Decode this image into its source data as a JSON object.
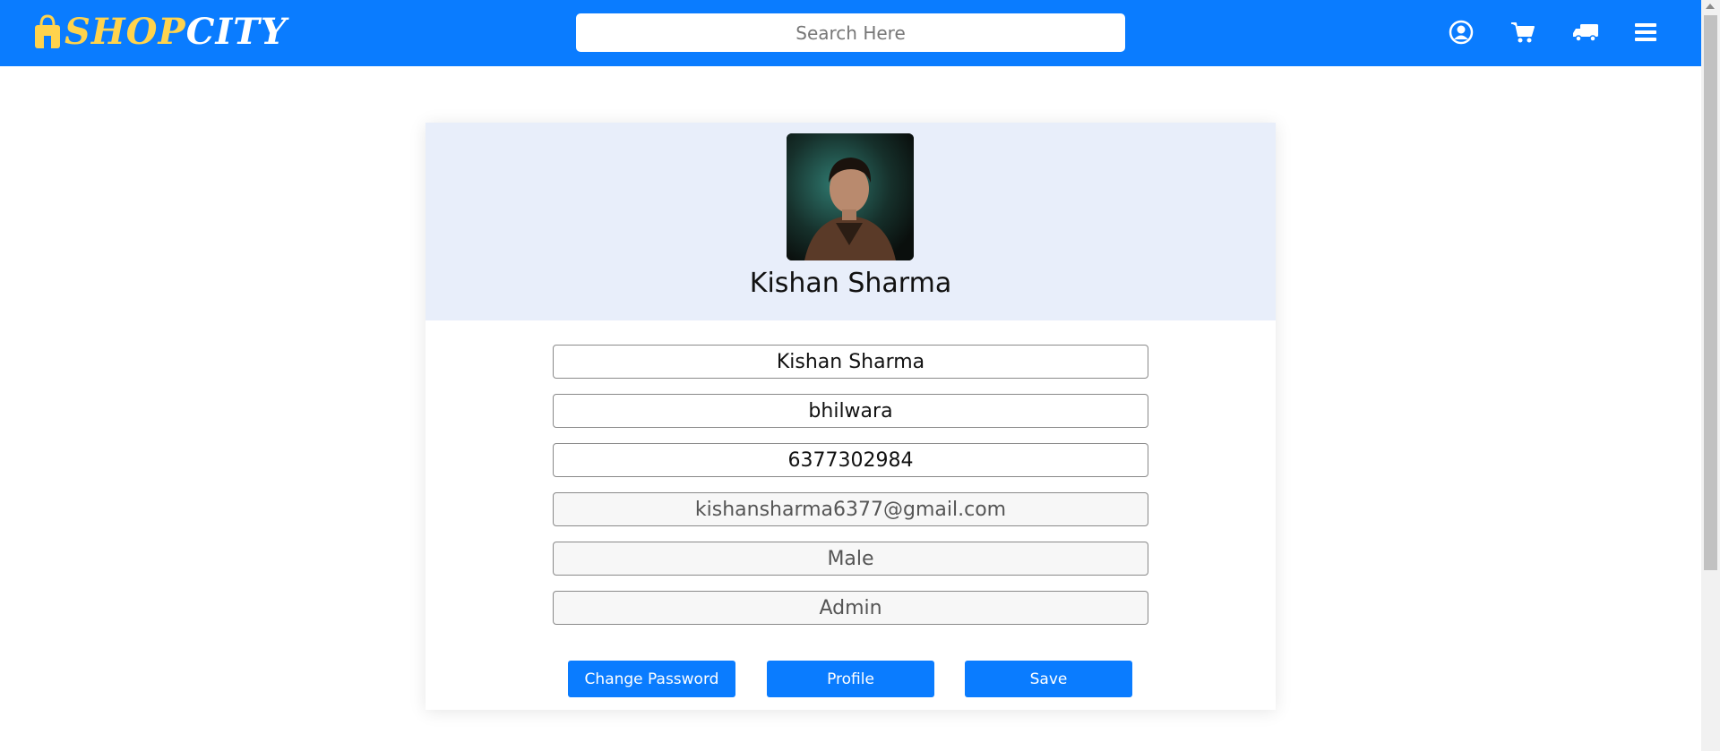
{
  "header": {
    "logo": {
      "shop": "SHOP",
      "city": "CITY"
    },
    "search": {
      "placeholder": "Search Here",
      "value": ""
    },
    "icons": [
      "user-circle-icon",
      "cart-icon",
      "truck-icon",
      "menu-icon"
    ],
    "colors": {
      "bar": "#0a7cff",
      "logo_shop": "#ffd34d",
      "logo_city": "#ffffff"
    }
  },
  "profile": {
    "name": "Kishan Sharma",
    "fields": {
      "name": "Kishan Sharma",
      "city": "bhilwara",
      "phone": "6377302984",
      "email": "kishansharma6377@gmail.com",
      "gender": "Male",
      "role": "Admin"
    },
    "buttons": {
      "change_password": "Change Password",
      "profile": "Profile",
      "save": "Save"
    },
    "colors": {
      "header_bg": "#e8eefa",
      "button": "#0a7cff"
    }
  }
}
